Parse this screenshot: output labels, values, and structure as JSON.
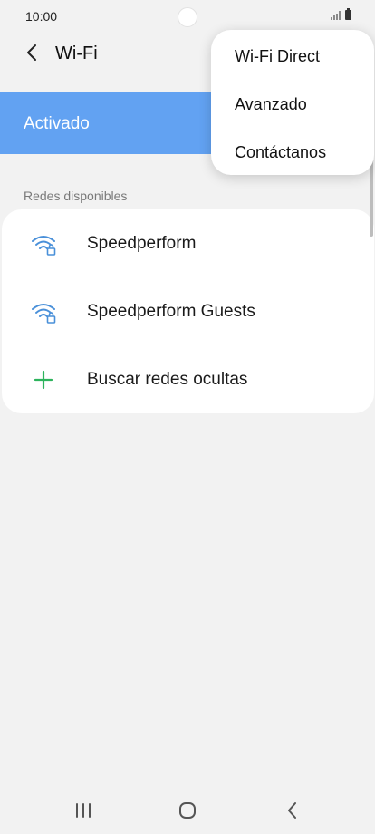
{
  "status_bar": {
    "time": "10:00",
    "icons": [
      "signal-icon",
      "battery-icon"
    ]
  },
  "app_bar": {
    "title": "Wi-Fi",
    "back_icon": "chevron-left-icon"
  },
  "wifi_toggle": {
    "label": "Activado",
    "state": "on",
    "accent_color": "#62a2f2"
  },
  "available_networks": {
    "header": "Redes disponibles",
    "items": [
      {
        "name": "Speedperform",
        "icon": "wifi-lock-icon"
      },
      {
        "name": "Speedperform Guests",
        "icon": "wifi-lock-icon"
      },
      {
        "name": "Buscar redes ocultas",
        "icon": "plus-icon"
      }
    ]
  },
  "overflow_menu": {
    "items": [
      {
        "label": "Wi-Fi Direct"
      },
      {
        "label": "Avanzado"
      },
      {
        "label": "Contáctanos"
      }
    ]
  },
  "nav_bar": {
    "buttons": [
      "recents-icon",
      "home-icon",
      "back-icon"
    ]
  },
  "colors": {
    "wifi_icon": "#4a90d9",
    "plus_icon": "#2db35d",
    "background": "#f2f2f2"
  }
}
